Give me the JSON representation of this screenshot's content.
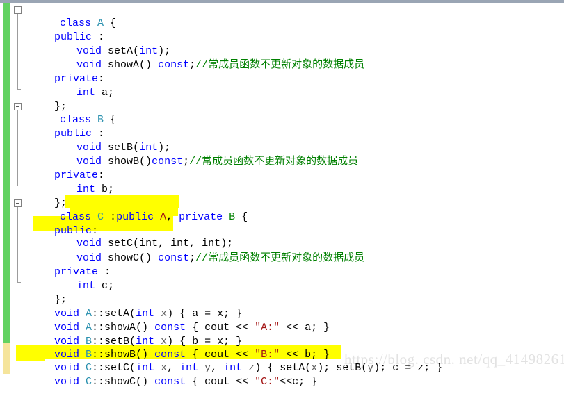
{
  "app": {
    "kind": "code-editor",
    "language": "C++",
    "colors": {
      "keyword": "#0000ff",
      "type": "#2b91af",
      "string": "#a31515",
      "comment": "#008000",
      "identifier": "#5d5d5d",
      "highlight": "#ffff00",
      "changed_margin": "#62d261",
      "saved_margin": "#f5e49b",
      "splitter": "#9aa5b4",
      "background": "#ffffff"
    }
  },
  "watermark": {
    "text": "https://blog. csdn. net/qq_41498261"
  },
  "comment_text": "//常成员函数不更新对象的数据成员",
  "code": {
    "lines": [
      {
        "n": 1,
        "text": "class A {"
      },
      {
        "n": 2,
        "text": " public :"
      },
      {
        "n": 3,
        "text": "     void setA(int);"
      },
      {
        "n": 4,
        "text": "     void showA() const;//常成员函数不更新对象的数据成员"
      },
      {
        "n": 5,
        "text": " private:"
      },
      {
        "n": 6,
        "text": "     int a;"
      },
      {
        "n": 7,
        "text": " };"
      },
      {
        "n": 8,
        "text": "class B {"
      },
      {
        "n": 9,
        "text": " public :"
      },
      {
        "n": 10,
        "text": "     void setB(int);"
      },
      {
        "n": 11,
        "text": "     void showB()const;//常成员函数不更新对象的数据成员"
      },
      {
        "n": 12,
        "text": " private:"
      },
      {
        "n": 13,
        "text": "     int b;"
      },
      {
        "n": 14,
        "text": " };"
      },
      {
        "n": 15,
        "text": "class C :public A, private B {"
      },
      {
        "n": 16,
        "text": " public:"
      },
      {
        "n": 17,
        "text": "     void setC(int, int, int);"
      },
      {
        "n": 18,
        "text": "     void showC() const;//常成员函数不更新对象的数据成员"
      },
      {
        "n": 19,
        "text": " private :"
      },
      {
        "n": 20,
        "text": "     int c;"
      },
      {
        "n": 21,
        "text": " };"
      },
      {
        "n": 22,
        "text": " void A::setA(int x) { a = x; }"
      },
      {
        "n": 23,
        "text": " void A::showA() const { cout << \"A:\" << a; }"
      },
      {
        "n": 24,
        "text": " void B::setB(int x) { b = x; }"
      },
      {
        "n": 25,
        "text": " void B::showB() const { cout << \"B:\" << b; }"
      },
      {
        "n": 26,
        "text": " void C::setC(int x, int y, int z) { setA(x); setB(y); c = z; }"
      },
      {
        "n": 27,
        "text": " void C::showC() const { cout << \"C:\"<<c; }"
      }
    ]
  },
  "tokens": {
    "l1": [
      "class ",
      "A",
      " {"
    ],
    "l2": [
      "public",
      " :"
    ],
    "l3": [
      "void ",
      "setA",
      "(",
      "int",
      ");"
    ],
    "l4": [
      "void ",
      "showA",
      "() ",
      "const",
      ";",
      "//常成员函数不更新对象的数据成员"
    ],
    "l5": [
      "private",
      ":"
    ],
    "l6": [
      "int ",
      "a;"
    ],
    "l7": [
      "};"
    ],
    "l8": [
      "class ",
      "B",
      " {"
    ],
    "l9": [
      "public",
      " :"
    ],
    "l10": [
      "void ",
      "setB",
      "(",
      "int",
      ");"
    ],
    "l11": [
      "void ",
      "showB",
      "()",
      "const",
      ";",
      "//常成员函数不更新对象的数据成员"
    ],
    "l12": [
      "private",
      ":"
    ],
    "l13": [
      "int ",
      "b;"
    ],
    "l14": [
      "};"
    ],
    "l15": [
      "class ",
      "C",
      " :",
      "public ",
      "A",
      ", ",
      "private ",
      "B",
      " {"
    ],
    "l16": [
      "public",
      ":"
    ],
    "l17": [
      "void ",
      "setC",
      "(",
      "int",
      ", ",
      "int",
      ", ",
      "int",
      ");"
    ],
    "l18": [
      "void ",
      "showC",
      "() ",
      "const",
      ";",
      "//常成员函数不更新对象的数据成员"
    ],
    "l19": [
      "private",
      " :"
    ],
    "l20": [
      "int ",
      "c;"
    ],
    "l21": [
      "};"
    ],
    "l22": [
      "void ",
      "A",
      "::setA(",
      "int ",
      "x",
      ") { a = x; }"
    ],
    "l23": [
      "void ",
      "A",
      "::showA() ",
      "const",
      " { cout << ",
      "\"A:\"",
      " << a; }"
    ],
    "l24": [
      "void ",
      "B",
      "::setB(",
      "int ",
      "x",
      ") { b = x; }"
    ],
    "l25": [
      "void ",
      "B",
      "::showB() ",
      "const",
      " { cout << ",
      "\"B:\"",
      " << b; }"
    ],
    "l26": [
      "void ",
      "C",
      "::setC(",
      "int ",
      "x",
      ", ",
      "int ",
      "y",
      ", ",
      "int ",
      "z",
      ") { setA(",
      "x",
      "); setB(",
      "y",
      "); c = z; }"
    ],
    "l27": [
      "void ",
      "C",
      "::showC() ",
      "const",
      " { cout << ",
      "\"C:\"",
      "<<c; }"
    ]
  },
  "highlights": [
    {
      "name": "highlight-class-c-bases",
      "label": ":public A, private B"
    },
    {
      "name": "highlight-public-gap",
      "label": ""
    },
    {
      "name": "highlight-setc-decl",
      "label": "void setC(int, int, int);"
    },
    {
      "name": "highlight-setc-def",
      "label": "void C::setC(int x, int y, int z) { setA(x); setB(y); c = z; }"
    }
  ]
}
